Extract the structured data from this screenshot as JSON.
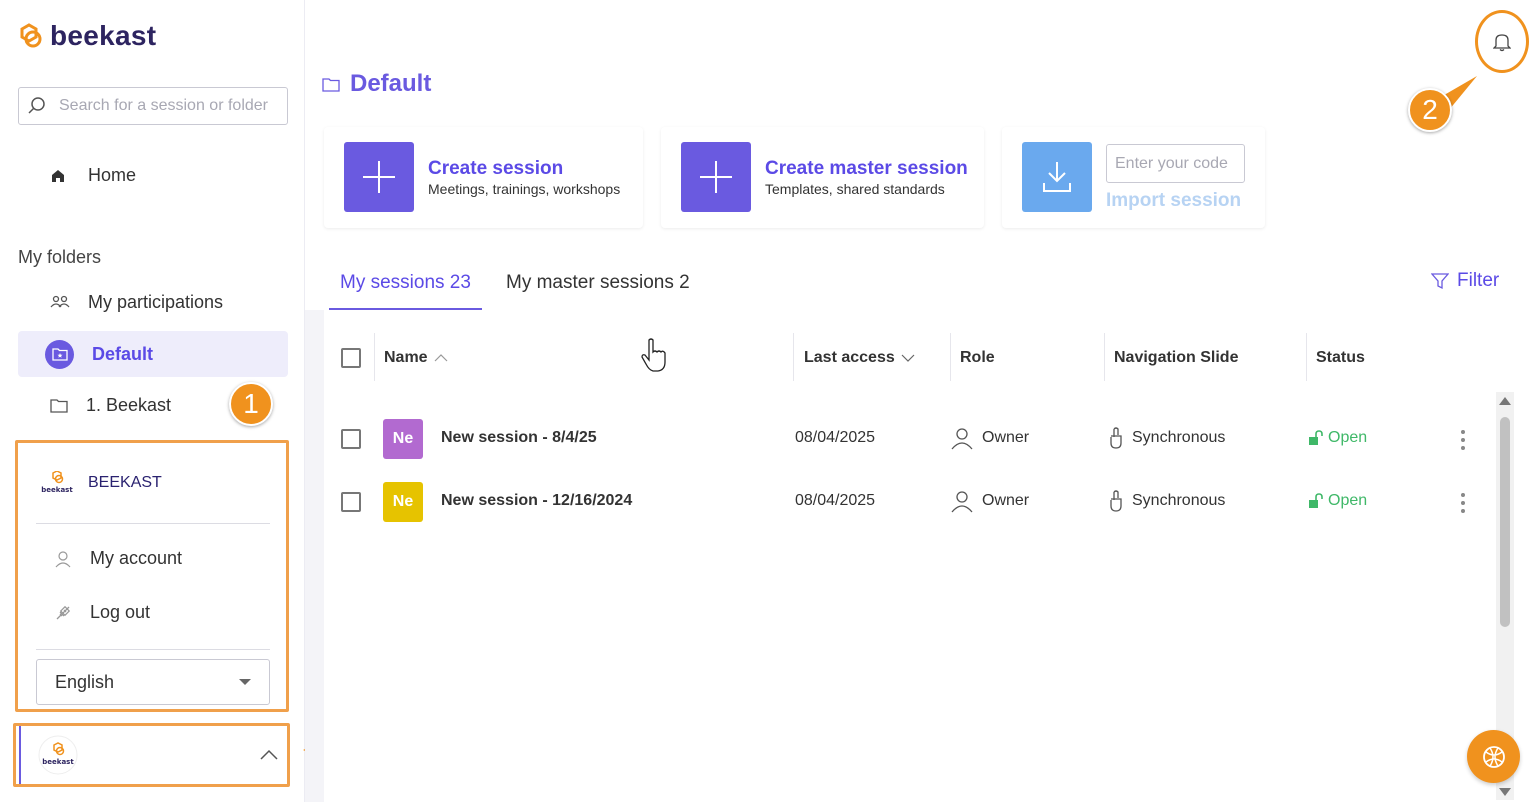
{
  "app": {
    "brand": "beekast"
  },
  "sidebar": {
    "search_placeholder": "Search for a session or folder",
    "home_label": "Home",
    "folders_title": "My folders",
    "items": [
      {
        "label": "My participations",
        "icon": "participants-icon"
      },
      {
        "label": "Default",
        "icon": "folder-star-icon",
        "active": true
      },
      {
        "label": "1. Beekast",
        "icon": "folder-icon"
      }
    ]
  },
  "user_menu": {
    "org_name": "BEEKAST",
    "org_logo_text": "beekast",
    "items": [
      {
        "label": "My account",
        "icon": "user-icon"
      },
      {
        "label": "Log out",
        "icon": "logout-icon"
      }
    ],
    "language": "English",
    "footer_logo_text": "beekast"
  },
  "annotations": {
    "badge_1": "1",
    "badge_2": "2"
  },
  "main": {
    "breadcrumb": "Default",
    "cards": {
      "create": {
        "title": "Create session",
        "subtitle": "Meetings, trainings, workshops"
      },
      "create_master": {
        "title": "Create master session",
        "subtitle": "Templates, shared standards"
      },
      "import": {
        "placeholder": "Enter your code",
        "label": "Import session"
      }
    },
    "tabs": [
      {
        "label": "My sessions 23",
        "active": true
      },
      {
        "label": "My master sessions 2",
        "active": false
      }
    ],
    "filter_label": "Filter",
    "table": {
      "headers": {
        "name": "Name",
        "last_access": "Last access",
        "role": "Role",
        "navigation": "Navigation Slide",
        "status": "Status"
      },
      "rows": [
        {
          "initials": "Ne",
          "avatar_color": "#b26ad0",
          "name": "New session - 8/4/25",
          "last_access": "08/04/2025",
          "role": "Owner",
          "navigation": "Synchronous",
          "status": "Open"
        },
        {
          "initials": "Ne",
          "avatar_color": "#e6c300",
          "name": "New session - 12/16/2024",
          "last_access": "08/04/2025",
          "role": "Owner",
          "navigation": "Synchronous",
          "status": "Open"
        }
      ]
    }
  },
  "colors": {
    "accent": "#6a5ae0",
    "annotation": "#f0921e",
    "status_open": "#3fb868",
    "import_tile": "#6aa9ee"
  }
}
